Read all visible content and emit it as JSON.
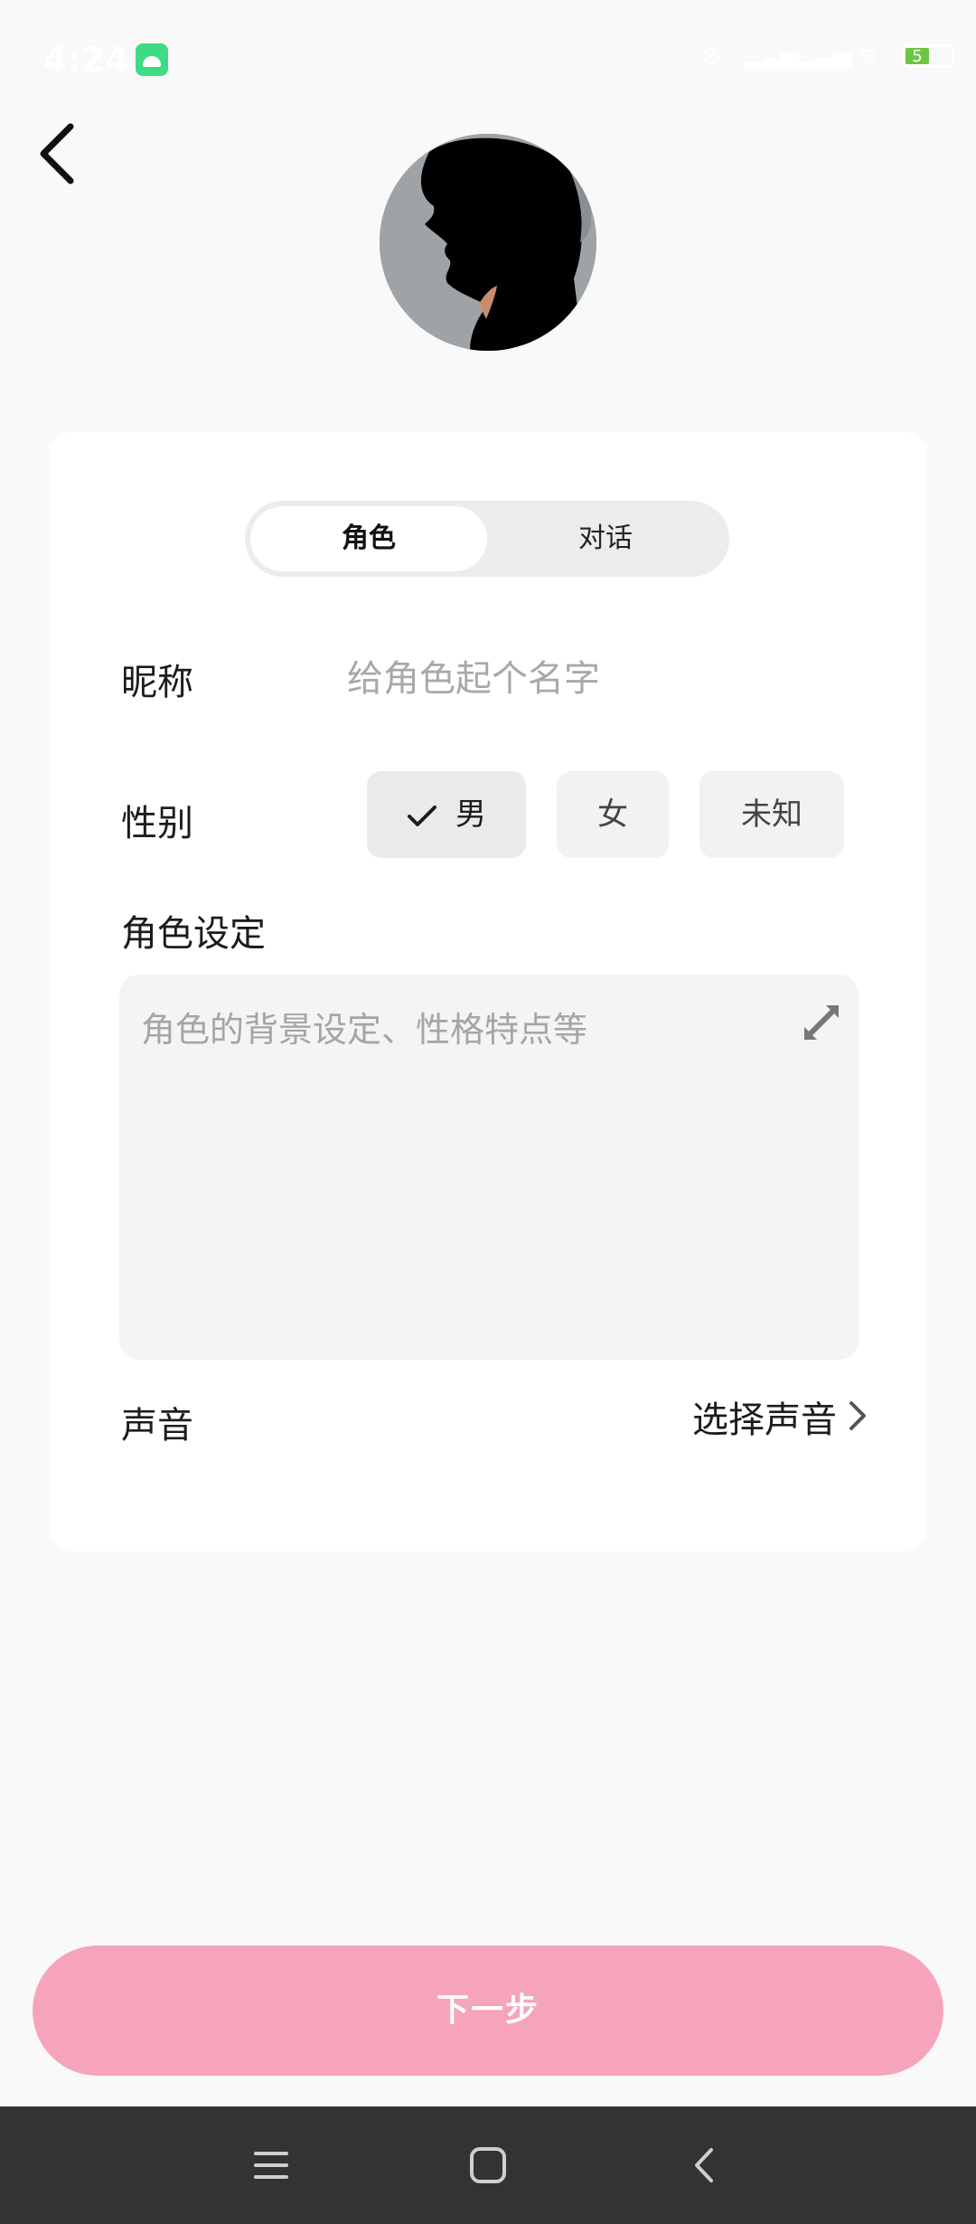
{
  "status_bar": {
    "time": "4:24",
    "battery": "5"
  },
  "header": {
    "back_icon": "chevron-left-icon"
  },
  "tabs": [
    {
      "label": "角色",
      "active": true
    },
    {
      "label": "对话",
      "active": false
    }
  ],
  "form": {
    "nickname_label": "昵称",
    "nickname_placeholder": "给角色起个名字",
    "gender_label": "性别",
    "gender_options": [
      {
        "label": "男",
        "selected": true
      },
      {
        "label": "女",
        "selected": false
      },
      {
        "label": "未知",
        "selected": false
      }
    ],
    "setting_label": "角色设定",
    "setting_placeholder": "角色的背景设定、性格特点等",
    "voice_label": "声音",
    "voice_value": "选择声音"
  },
  "footer": {
    "next_label": "下一步"
  },
  "colors": {
    "primary_button": "#f6a4bb",
    "card": "#ffffff",
    "background": "#f9f9f9"
  }
}
